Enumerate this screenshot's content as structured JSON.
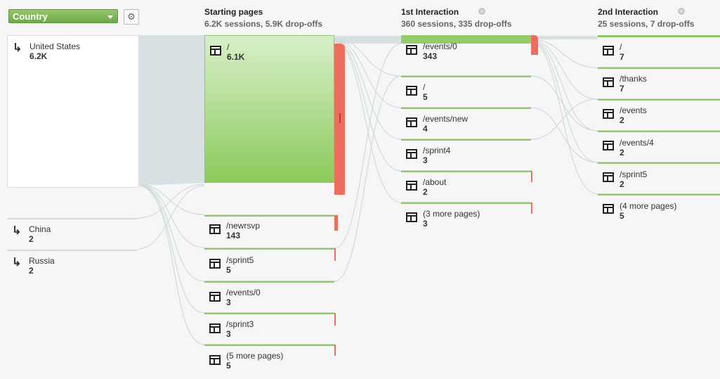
{
  "controls": {
    "dimension": "Country"
  },
  "icons": {
    "dimension_caret": "chevron-down-icon",
    "settings": "gear-icon",
    "page": "page-icon",
    "entry": "arrow-right-icon",
    "close": "close-icon"
  },
  "colors": {
    "accent_green": "#8dc968",
    "dropoff_red": "#ef6d5d",
    "flow_grey": "#d6dee0"
  },
  "countries": [
    {
      "name": "United States",
      "count": "6.2K"
    },
    {
      "name": "China",
      "count": "2"
    },
    {
      "name": "Russia",
      "count": "2"
    }
  ],
  "columns": [
    {
      "title": "Starting pages",
      "subtitle": "6.2K sessions, 5.9K drop-offs",
      "nodes": [
        {
          "page": "/",
          "count": "6.1K"
        },
        {
          "page": "/newrsvp",
          "count": "143"
        },
        {
          "page": "/sprint5",
          "count": "5"
        },
        {
          "page": "/events/0",
          "count": "3"
        },
        {
          "page": "/sprint3",
          "count": "3"
        },
        {
          "page": "(5 more pages)",
          "count": "5"
        }
      ]
    },
    {
      "title": "1st Interaction",
      "subtitle": "360 sessions, 335 drop-offs",
      "nodes": [
        {
          "page": "/events/0",
          "count": "343"
        },
        {
          "page": "/",
          "count": "5"
        },
        {
          "page": "/events/new",
          "count": "4"
        },
        {
          "page": "/sprint4",
          "count": "3"
        },
        {
          "page": "/about",
          "count": "2"
        },
        {
          "page": "(3 more pages)",
          "count": "3"
        }
      ]
    },
    {
      "title": "2nd Interaction",
      "subtitle": "25 sessions, 7 drop-offs",
      "nodes": [
        {
          "page": "/",
          "count": "7"
        },
        {
          "page": "/thanks",
          "count": "7"
        },
        {
          "page": "/events",
          "count": "2"
        },
        {
          "page": "/events/4",
          "count": "2"
        },
        {
          "page": "/sprint5",
          "count": "2"
        },
        {
          "page": "(4 more pages)",
          "count": "5"
        }
      ]
    }
  ]
}
